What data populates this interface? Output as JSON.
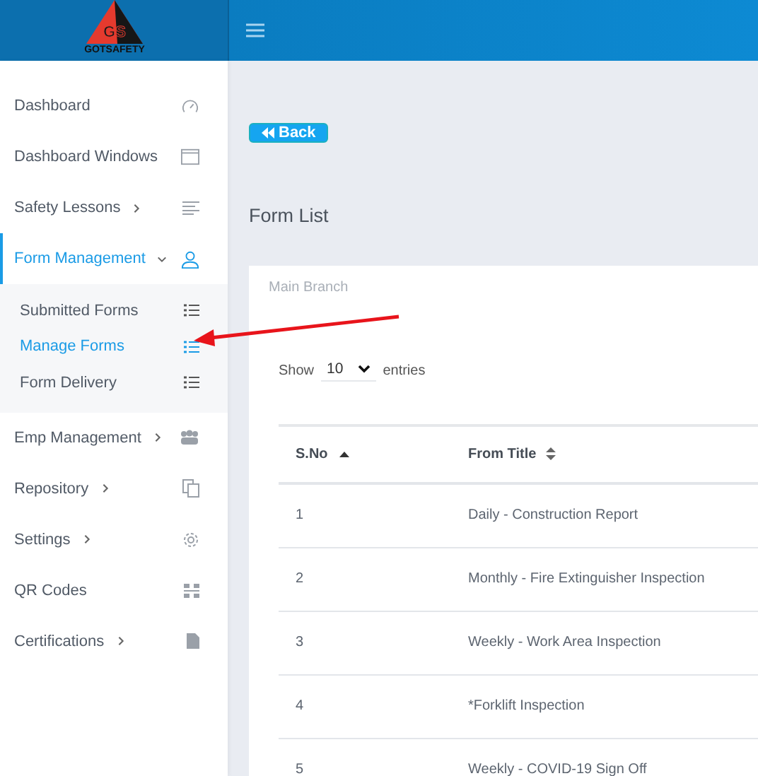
{
  "logo": {
    "mark": "GS",
    "name": "GOTSAFETY"
  },
  "sidebar": {
    "items": [
      {
        "label": "Dashboard",
        "selected": false,
        "submenu": false
      },
      {
        "label": "Dashboard Windows",
        "selected": false,
        "submenu": false
      },
      {
        "label": "Safety Lessons",
        "selected": false,
        "submenu": true,
        "expanded": false
      },
      {
        "label": "Form Management",
        "selected": true,
        "submenu": true,
        "expanded": true,
        "children": [
          {
            "label": "Submitted Forms",
            "selected": false
          },
          {
            "label": "Manage Forms",
            "selected": true
          },
          {
            "label": "Form Delivery",
            "selected": false
          }
        ]
      },
      {
        "label": "Emp Management",
        "selected": false,
        "submenu": true,
        "expanded": false
      },
      {
        "label": "Repository",
        "selected": false,
        "submenu": true,
        "expanded": false
      },
      {
        "label": "Settings",
        "selected": false,
        "submenu": true,
        "expanded": false
      },
      {
        "label": "QR Codes",
        "selected": false,
        "submenu": false
      },
      {
        "label": "Certifications",
        "selected": false,
        "submenu": true,
        "expanded": false
      }
    ]
  },
  "back_button": {
    "label": "Back"
  },
  "page_title": "Form List",
  "card": {
    "branch": "Main Branch",
    "length": {
      "prefix": "Show",
      "value": "10",
      "suffix": "entries"
    },
    "table": {
      "columns": [
        {
          "label": "S.No",
          "sorted": true
        },
        {
          "label": "From Title",
          "sorted": false
        }
      ],
      "rows": [
        [
          "1",
          "Daily - Construction Report"
        ],
        [
          "2",
          "Monthly - Fire Extinguisher Inspection"
        ],
        [
          "3",
          "Weekly - Work Area Inspection"
        ],
        [
          "4",
          "*Forklift Inspection"
        ],
        [
          "5",
          "Weekly - COVID-19 Sign Off"
        ]
      ]
    }
  }
}
